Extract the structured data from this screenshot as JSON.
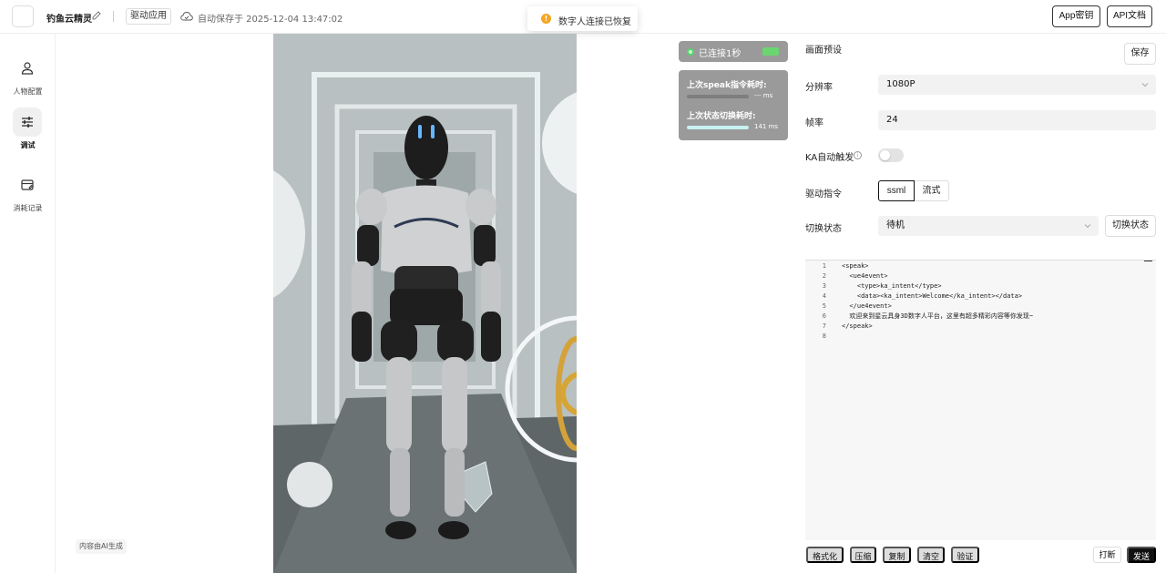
{
  "header": {
    "app_name": "钓鱼云精灵",
    "drive_tag": "驱动应用",
    "autosave": "自动保存于 2025-12-04 13:47:02",
    "toast": "数字人连接已恢复",
    "app_key_btn": "App密钥",
    "api_doc_btn": "API文档"
  },
  "sidebar": {
    "items": [
      {
        "label": "人物配置",
        "icon": "person-icon",
        "active": false
      },
      {
        "label": "调试",
        "icon": "sliders-icon",
        "active": true
      },
      {
        "label": "消耗记录",
        "icon": "record-icon",
        "active": false
      }
    ],
    "ai_tag": "内容由AI生成"
  },
  "status": {
    "connected": "已连接1秒",
    "speak_label": "上次speak指令耗时:",
    "speak_value": "--- ms",
    "switch_label": "上次状态切换耗时:",
    "switch_value": "141 ms",
    "switch_fraction": 1.0,
    "speak_fraction": 0
  },
  "panel": {
    "title": "画面预设",
    "save": "保存",
    "resolution_label": "分辨率",
    "resolution_value": "1080P",
    "fps_label": "帧率",
    "fps_value": "24",
    "ka_label": "KA自动触发",
    "ka_enabled": false,
    "drive_label": "驱动指令",
    "drive_options": [
      "ssml",
      "流式"
    ],
    "drive_selected": "ssml",
    "state_label": "切换状态",
    "state_value": "待机",
    "switch_btn": "切换状态"
  },
  "editor": {
    "lines": [
      {
        "n": "1",
        "code": "<speak>"
      },
      {
        "n": "2",
        "code": "  <ue4event>"
      },
      {
        "n": "3",
        "code": "    <type>ka_intent</type>"
      },
      {
        "n": "4",
        "code": "    <data><ka_intent>Welcome</ka_intent></data>"
      },
      {
        "n": "5",
        "code": "  </ue4event>"
      },
      {
        "n": "6",
        "code": "  欢迎来到星云具身3D数字人平台，这里有超多精彩内容等你发现~"
      },
      {
        "n": "7",
        "code": "</speak>"
      },
      {
        "n": "8",
        "code": ""
      }
    ]
  },
  "actions": {
    "format": "格式化",
    "compress": "压缩",
    "copy": "复制",
    "clear": "清空",
    "verify": "验证",
    "interrupt": "打断",
    "send": "发送"
  }
}
